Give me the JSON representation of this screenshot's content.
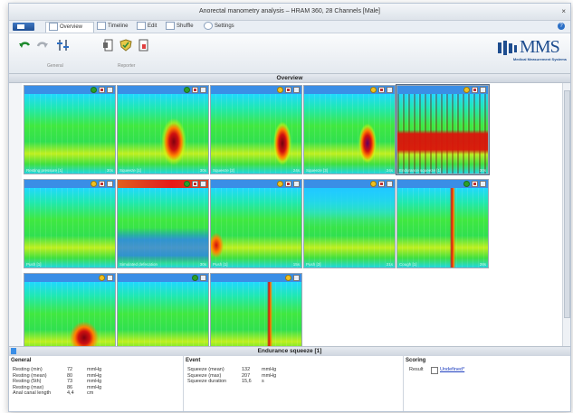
{
  "window": {
    "title": "Anorectal manometry analysis – HRAM 360, 28 Channels [Male]",
    "close": "×"
  },
  "tabs": [
    {
      "label": "Overview",
      "active": true
    },
    {
      "label": "Timeline",
      "active": false
    },
    {
      "label": "Edit",
      "active": false
    },
    {
      "label": "Shuffle",
      "active": false
    },
    {
      "label": "Settings",
      "active": false
    }
  ],
  "help": "?",
  "ribbon": {
    "group_general": "General",
    "group_reporter": "Reporter"
  },
  "logo": {
    "text": "MMS",
    "subtitle": "Medical Measurement Systems"
  },
  "overview_title": "Overview",
  "tiles": [
    {
      "label": "Resting pressure [1]",
      "duration": "30s",
      "status": "ok",
      "pattern": "rest",
      "bar": "blue"
    },
    {
      "label": "Squeeze [1]",
      "duration": "30s",
      "status": "ok",
      "pattern": "squeeze",
      "bar": "blue"
    },
    {
      "label": "Squeeze [2]",
      "duration": "24s",
      "status": "warn",
      "pattern": "squeeze2",
      "bar": "blue"
    },
    {
      "label": "Squeeze [3]",
      "duration": "24s",
      "status": "warn",
      "pattern": "squeeze3",
      "bar": "blue"
    },
    {
      "label": "Endurance squeeze [1]",
      "duration": "30s",
      "status": "warn",
      "pattern": "endurance",
      "bar": "blue",
      "selected": true
    },
    {
      "label": "Push [1]",
      "duration": "",
      "status": "warn",
      "pattern": "push",
      "bar": "blue"
    },
    {
      "label": "Simulated defecation",
      "duration": "30s",
      "status": "ok",
      "pattern": "sim",
      "bar": "red"
    },
    {
      "label": "Push [1]",
      "duration": "15s",
      "status": "warn",
      "pattern": "push2",
      "bar": "blue"
    },
    {
      "label": "Push [2]",
      "duration": "21s",
      "status": "warn",
      "pattern": "push3",
      "bar": "blue"
    },
    {
      "label": "Cough [1]",
      "duration": "28s",
      "status": "ok",
      "pattern": "cough",
      "bar": "blue"
    },
    {
      "label": "",
      "duration": "",
      "status": "warn",
      "pattern": "lower1",
      "bar": "blue",
      "partial": true
    },
    {
      "label": "",
      "duration": "",
      "status": "ok",
      "pattern": "lower2",
      "bar": "blue",
      "partial": true
    },
    {
      "label": "",
      "duration": "",
      "status": "warn",
      "pattern": "lower3",
      "bar": "blue",
      "partial": true
    }
  ],
  "detail_title": "Endurance squeeze [1]",
  "general": {
    "title": "General",
    "rows": [
      {
        "label": "Resting (min)",
        "value": "72",
        "unit": "mmHg"
      },
      {
        "label": "Resting (mean)",
        "value": "80",
        "unit": "mmHg"
      },
      {
        "label": "Resting (5th)",
        "value": "73",
        "unit": "mmHg"
      },
      {
        "label": "Resting (max)",
        "value": "86",
        "unit": "mmHg"
      },
      {
        "label": "Anal canal length",
        "value": "4,4",
        "unit": "cm"
      }
    ]
  },
  "event": {
    "title": "Event",
    "rows": [
      {
        "label": "Squeeze (mean)",
        "value": "132",
        "unit": "mmHg"
      },
      {
        "label": "Squeeze (max)",
        "value": "207",
        "unit": "mmHg"
      },
      {
        "label": "Squeeze duration",
        "value": "15,6",
        "unit": "s"
      }
    ]
  },
  "scoring": {
    "title": "Scoring",
    "result_label": "Result",
    "result_value": "Undefined*"
  },
  "colors": {
    "accent": "#3a8ee6",
    "heat_low": "#18c8ff",
    "heat_mid": "#20e060",
    "heat_high": "#d01010"
  }
}
